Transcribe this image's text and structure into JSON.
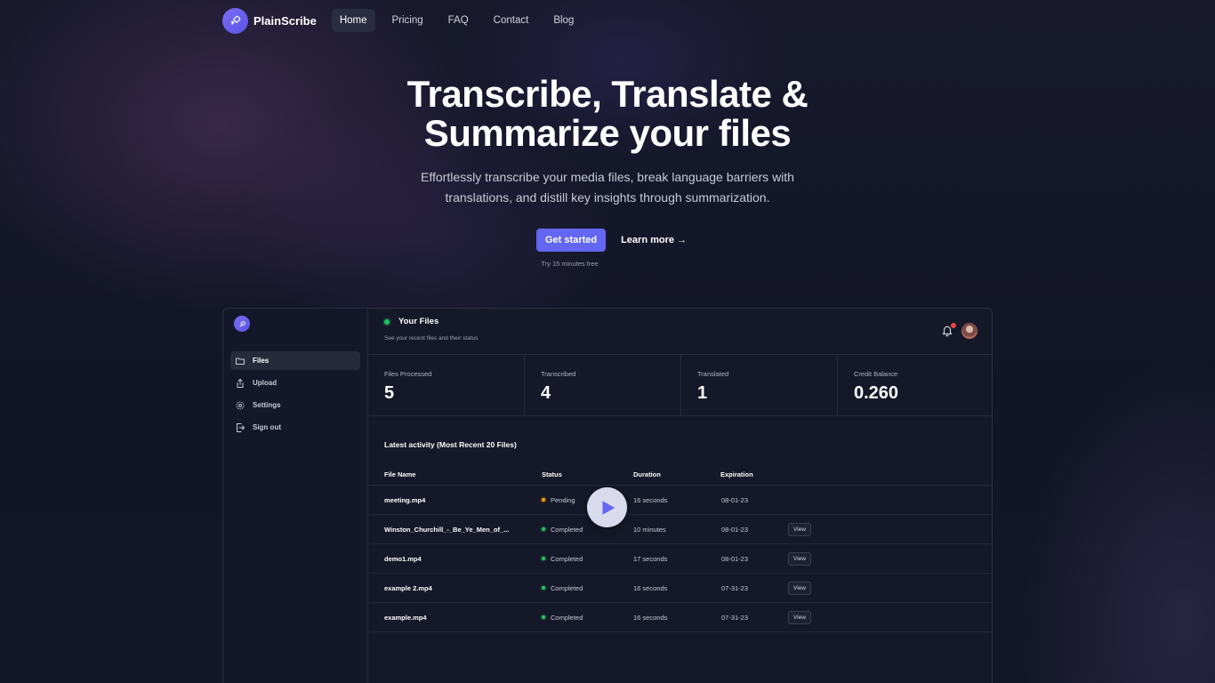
{
  "nav": {
    "brand": "PlainScribe",
    "links": [
      "Home",
      "Pricing",
      "FAQ",
      "Contact",
      "Blog"
    ]
  },
  "hero": {
    "title_line1": "Transcribe, Translate &",
    "title_line2": "Summarize your files",
    "subtitle": "Effortlessly transcribe your media files, break language barriers with translations, and distill key insights through summarization.",
    "cta_primary": "Get started",
    "cta_secondary": "Learn more →",
    "note": "Try 15 minutes free"
  },
  "app": {
    "sidebar": [
      "Files",
      "Upload",
      "Settings",
      "Sign out"
    ],
    "header": {
      "title": "Your Files",
      "subtitle": "See your recent files and their status"
    },
    "stats": [
      {
        "label": "Files Processed",
        "value": "5"
      },
      {
        "label": "Transcribed",
        "value": "4"
      },
      {
        "label": "Translated",
        "value": "1"
      },
      {
        "label": "Credit Balance",
        "value": "0.260"
      }
    ],
    "activity_title": "Latest activity (Most Recent 20 Files)",
    "columns": [
      "File Name",
      "Status",
      "Duration",
      "Expiration"
    ],
    "rows": [
      {
        "name": "meeting.mp4",
        "status": "Pending",
        "duration": "16 seconds",
        "expiration": "08-01-23",
        "action": ""
      },
      {
        "name": "Winston_Churchill_-_Be_Ye_Men_of_...",
        "status": "Completed",
        "duration": "10 minutes",
        "expiration": "08-01-23",
        "action": "View"
      },
      {
        "name": "demo1.mp4",
        "status": "Completed",
        "duration": "17 seconds",
        "expiration": "08-01-23",
        "action": "View"
      },
      {
        "name": "example 2.mp4",
        "status": "Completed",
        "duration": "16 seconds",
        "expiration": "07-31-23",
        "action": "View"
      },
      {
        "name": "example.mp4",
        "status": "Completed",
        "duration": "16 seconds",
        "expiration": "07-31-23",
        "action": "View"
      }
    ]
  },
  "colors": {
    "accent": "#6366f1",
    "background": "#121527",
    "completed": "#22c55e",
    "pending": "#f59e0b"
  }
}
